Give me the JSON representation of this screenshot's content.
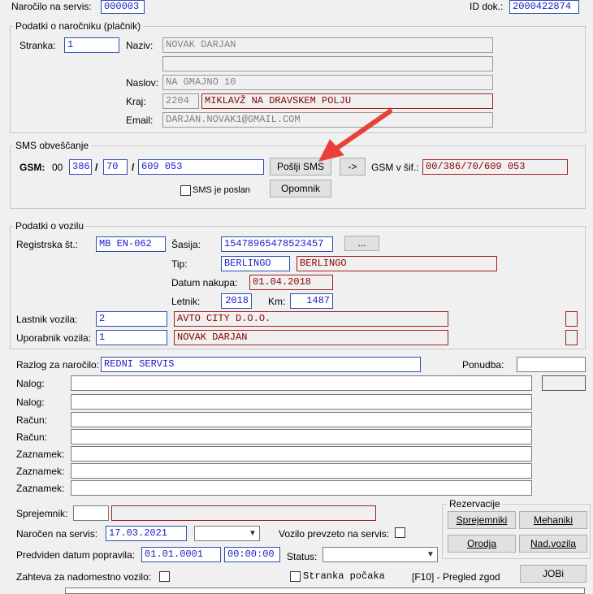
{
  "header": {
    "order_label": "Naročilo na servis:",
    "order_value": "000003",
    "doc_id_label": "ID dok.:",
    "doc_id_value": "2000422874"
  },
  "customer": {
    "group_title": "Podatki o naročniku (plačnik)",
    "stranka_label": "Stranka:",
    "stranka_value": "1",
    "naziv_label": "Naziv:",
    "naziv_value": "NOVAK DARJAN",
    "naziv2_value": "",
    "naslov_label": "Naslov:",
    "naslov_value": "NA GMAJNO 10",
    "kraj_label": "Kraj:",
    "kraj_code": "2204",
    "kraj_name": "MIKLAVŽ NA DRAVSKEM POLJU",
    "email_label": "Email:",
    "email_value": "DARJAN.NOVAK1@GMAIL.COM"
  },
  "sms": {
    "group_title": "SMS obveščanje",
    "gsm_label": "GSM:",
    "prefix": "00",
    "country": "386",
    "sep1": "/",
    "area": "70",
    "sep2": "/",
    "number": "609 053",
    "send_button": "Pošlji SMS",
    "arrow_button": "->",
    "gsm_sif_label": "GSM v šif.:",
    "gsm_sif_value": "00/386/70/609 053",
    "sent_label": "SMS je poslan",
    "reminder_button": "Opomnik"
  },
  "vehicle": {
    "group_title": "Podatki o vozilu",
    "reg_label": "Registrska št.:",
    "reg_value": "MB EN-062",
    "sasija_label": "Šasija:",
    "sasija_value": "15478965478523457",
    "browse_button": "...",
    "tip_label": "Tip:",
    "tip_code": "BERLINGO",
    "tip_name": "BERLINGO",
    "datum_label": "Datum nakupa:",
    "datum_value": "01.04.2018",
    "letnik_label": "Letnik:",
    "letnik_value": "2018",
    "km_label": "Km:",
    "km_value": "1487",
    "owner_label": "Lastnik vozila:",
    "owner_code": "2",
    "owner_name": "AVTO CITY D.O.O.",
    "user_label": "Uporabnik vozila:",
    "user_code": "1",
    "user_name": "NOVAK DARJAN"
  },
  "order": {
    "razlog_label": "Razlog za naročilo:",
    "razlog_value": "REDNI SERVIS",
    "ponudba_label": "Ponudba:",
    "ponudba_value": "",
    "nalog1_label": "Nalog:",
    "nalog2_label": "Nalog:",
    "racun1_label": "Račun:",
    "racun2_label": "Račun:",
    "zaznamek1_label": "Zaznamek:",
    "zaznamek2_label": "Zaznamek:",
    "zaznamek3_label": "Zaznamek:"
  },
  "footer": {
    "sprejemnik_label": "Sprejemnik:",
    "narocen_label": "Naročen na servis:",
    "narocen_value": "17.03.2021",
    "prevzeto_label": "Vozilo prevzeto na servis:",
    "predviden_label": "Predviden datum popravila:",
    "predviden_date": "01.01.0001",
    "predviden_time": "00:00:00",
    "status_label": "Status:",
    "nadomestno_label": "Zahteva za nadomestno vozilo:",
    "caka_label": "Stranka počaka",
    "f10_label": "[F10] - Pregled zgod",
    "jobi_button": "JOBi"
  },
  "reservations": {
    "group_title": "Rezervacije",
    "sprejemniki": "Sprejemniki",
    "mehaniki": "Mehaniki",
    "orodja": "Orodja",
    "nadvozila": "Nad.vozila"
  },
  "colors": {
    "accent_border": "#2c4fb0",
    "readonly_text": "#808080",
    "red_border": "#a02020",
    "annotation_arrow": "#e8413a"
  }
}
